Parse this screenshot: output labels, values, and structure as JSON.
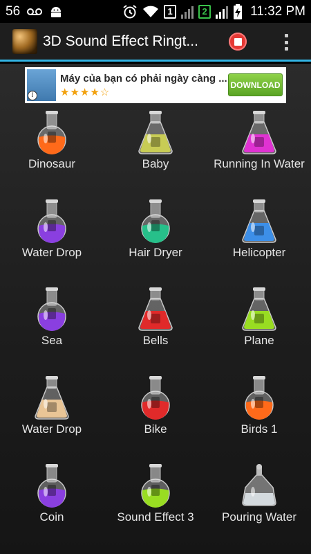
{
  "status_bar": {
    "signal_number": "56",
    "sim1": "1",
    "sim2": "2",
    "time": "11:32 PM"
  },
  "action_bar": {
    "title": "3D Sound Effect Ringt..."
  },
  "ad": {
    "title": "Máy của bạn có phải ngày càng ...",
    "stars": "★★★★☆",
    "rating": 4.5,
    "info_glyph": "i",
    "button_label": "DOWNLOAD"
  },
  "colors": {
    "accent": "#33b5e5",
    "orange": "#ff6a1a",
    "yellow_green": "#c8cc55",
    "magenta": "#e032d2",
    "purple": "#8a3fe0",
    "teal": "#27c08a",
    "blue": "#3d8fe8",
    "red": "#e02a2a",
    "lime": "#99dd22",
    "beige": "#e9c596",
    "clear": "#dfe6ea"
  },
  "sounds": [
    {
      "label": "Dinosaur",
      "flask": "round",
      "color": "orange"
    },
    {
      "label": "Baby",
      "flask": "conical",
      "color": "yellow_green"
    },
    {
      "label": "Running In Water",
      "flask": "conical",
      "color": "magenta"
    },
    {
      "label": "Water Drop",
      "flask": "round",
      "color": "purple"
    },
    {
      "label": "Hair Dryer",
      "flask": "round",
      "color": "teal"
    },
    {
      "label": "Helicopter",
      "flask": "conical",
      "color": "blue"
    },
    {
      "label": "Sea",
      "flask": "round",
      "color": "purple"
    },
    {
      "label": "Bells",
      "flask": "conical",
      "color": "red"
    },
    {
      "label": "Plane",
      "flask": "conical",
      "color": "lime"
    },
    {
      "label": "Water Drop",
      "flask": "conical",
      "color": "beige"
    },
    {
      "label": "Bike",
      "flask": "round",
      "color": "red"
    },
    {
      "label": "Birds 1",
      "flask": "round",
      "color": "orange"
    },
    {
      "label": "Coin",
      "flask": "round",
      "color": "purple"
    },
    {
      "label": "Sound Effect 3",
      "flask": "round",
      "color": "lime"
    },
    {
      "label": "Pouring Water",
      "flask": "dome",
      "color": "clear"
    }
  ]
}
